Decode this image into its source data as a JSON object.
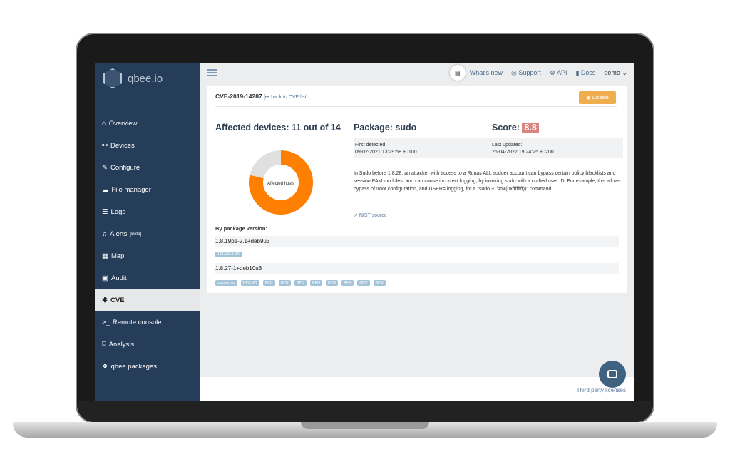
{
  "brand": "qbee.io",
  "sidebar": {
    "items": [
      {
        "label": "Overview",
        "icon": "home-icon"
      },
      {
        "label": "Devices",
        "icon": "sitemap-icon"
      },
      {
        "label": "Configure",
        "icon": "edit-icon"
      },
      {
        "label": "File manager",
        "icon": "cloud-upload-icon"
      },
      {
        "label": "Logs",
        "icon": "list-icon"
      },
      {
        "label": "Alerts",
        "badge": "[Beta]",
        "icon": "bell-icon"
      },
      {
        "label": "Map",
        "icon": "map-icon"
      },
      {
        "label": "Audit",
        "icon": "clipboard-icon"
      },
      {
        "label": "CVE",
        "icon": "bug-icon",
        "active": true
      },
      {
        "label": "Remote console",
        "icon": "terminal-icon"
      },
      {
        "label": "Analysis",
        "icon": "bank-icon"
      },
      {
        "label": "qbee packages",
        "icon": "cubes-icon"
      }
    ]
  },
  "topbar": {
    "whats_new": "What's new",
    "support": "Support",
    "api": "API",
    "docs": "Docs",
    "user": "demo"
  },
  "cve": {
    "id": "CVE-2019-14287",
    "back": "[⏮ back to CVE list]",
    "disable": "Disable",
    "affected": "Affected devices: 11 out of 14",
    "affected_count": 11,
    "total": 14,
    "chart_label": "Affected hosts",
    "package": "Package: sudo",
    "score_label": "Score:",
    "score": "8.8",
    "first_detected_label": "First detected:",
    "first_detected": "09-02-2021 13:29:58 +0100",
    "last_updated_label": "Last updated:",
    "last_updated": "26-04-2022 19:24:25 +0200",
    "description": "In Sudo before 1.8.28, an attacker with access to a Runas ALL sudoer account can bypass certain policy blacklists and session PAM modules, and can cause incorrect logging, by invoking sudo with a crafted user ID. For example, this allows bypass of !root configuration, and USER= logging, for a \"sudo -u \\#$((0xffffffff))\" command.",
    "nist": "NIST source",
    "by_version": "By package version:",
    "versions": [
      {
        "version": "1.8.19p1-2.1+deb9u3",
        "hosts": [
          "192.168.3.100"
        ]
      },
      {
        "version": "1.8.27-1+deb10u3",
        "hosts": [
          "raspberrypi",
          "RPI-HAT",
          "RPI1",
          "RPI2",
          "RPI3",
          "RPI4",
          "RPI5",
          "RPI6",
          "RPI7",
          "RPI8"
        ]
      }
    ]
  },
  "footer": "Third party licenses",
  "colors": {
    "sidebar": "#253d59",
    "affected": "#ff7f00",
    "unaffected": "#e0e0e0",
    "disable": "#f0ad4e",
    "score": "#d9847f"
  }
}
